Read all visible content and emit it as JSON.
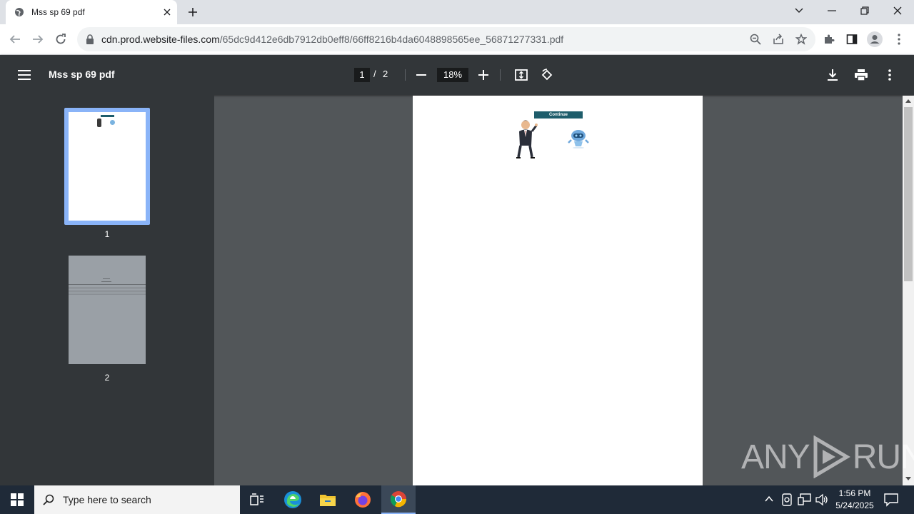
{
  "browser": {
    "tab_title": "Mss sp 69 pdf",
    "url_host": "cdn.prod.website-files.com",
    "url_path": "/65dc9d412e6db7912db0eff8/66ff8216b4da6048898565ee_56871277331.pdf"
  },
  "pdf_viewer": {
    "title": "Mss sp 69 pdf",
    "current_page": "1",
    "page_separator": "/",
    "total_pages": "2",
    "zoom": "18%"
  },
  "thumbnails": [
    {
      "label": "1"
    },
    {
      "label": "2"
    }
  ],
  "page_content": {
    "button_label": "Continue"
  },
  "watermark": {
    "left": "ANY",
    "right": "RUN"
  },
  "taskbar": {
    "search_placeholder": "Type here to search",
    "time": "1:56 PM",
    "date": "5/24/2025"
  },
  "colors": {
    "pdf_toolbar": "#323639",
    "viewer_bg": "#525659",
    "thumb_selected": "#8ab4f8",
    "continue_button": "#1e5d6b",
    "taskbar": "#1f2a38"
  }
}
